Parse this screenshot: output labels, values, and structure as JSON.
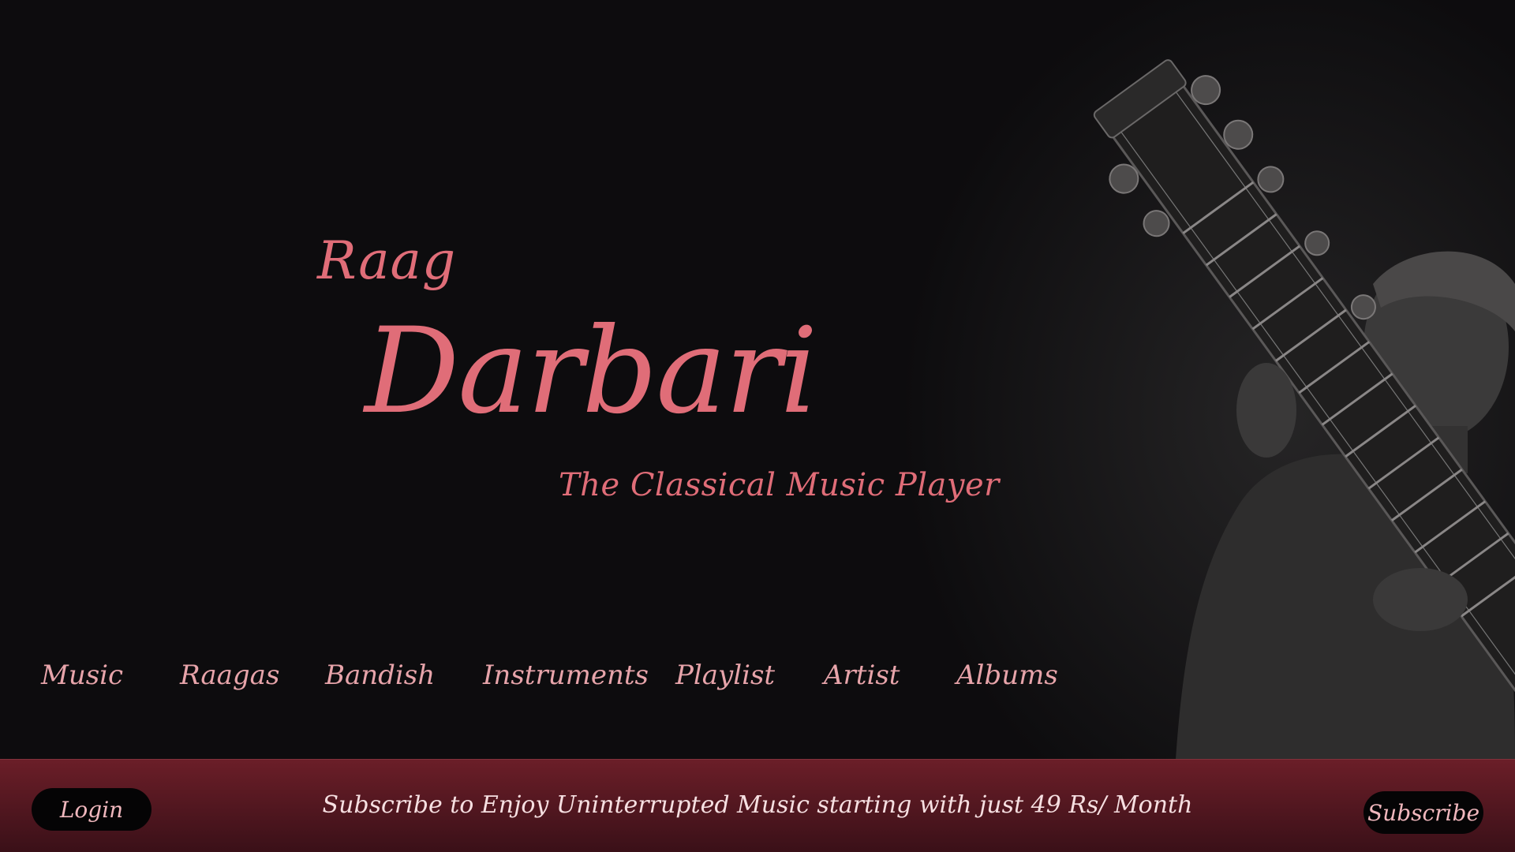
{
  "hero": {
    "title_small": "Raag",
    "title_large": "Darbari",
    "tagline": "The Classical Music Player"
  },
  "nav": {
    "items": [
      {
        "label": "Music"
      },
      {
        "label": "Raagas"
      },
      {
        "label": "Bandish"
      },
      {
        "label": "Instruments"
      },
      {
        "label": "Playlist"
      },
      {
        "label": "Artist"
      },
      {
        "label": "Albums"
      }
    ]
  },
  "footer": {
    "login_label": "Login",
    "promo_text": "Subscribe to Enjoy Uninterrupted Music starting with just 49 Rs/ Month",
    "subscribe_label": "Subscribe"
  },
  "colors": {
    "background": "#0d0c0e",
    "accent": "#e06d78",
    "nav_text": "#e7a4aa",
    "footer_band": "#6b1e28",
    "button_bg": "#050405"
  },
  "images": {
    "hero_art": "sitar-player-photo"
  }
}
